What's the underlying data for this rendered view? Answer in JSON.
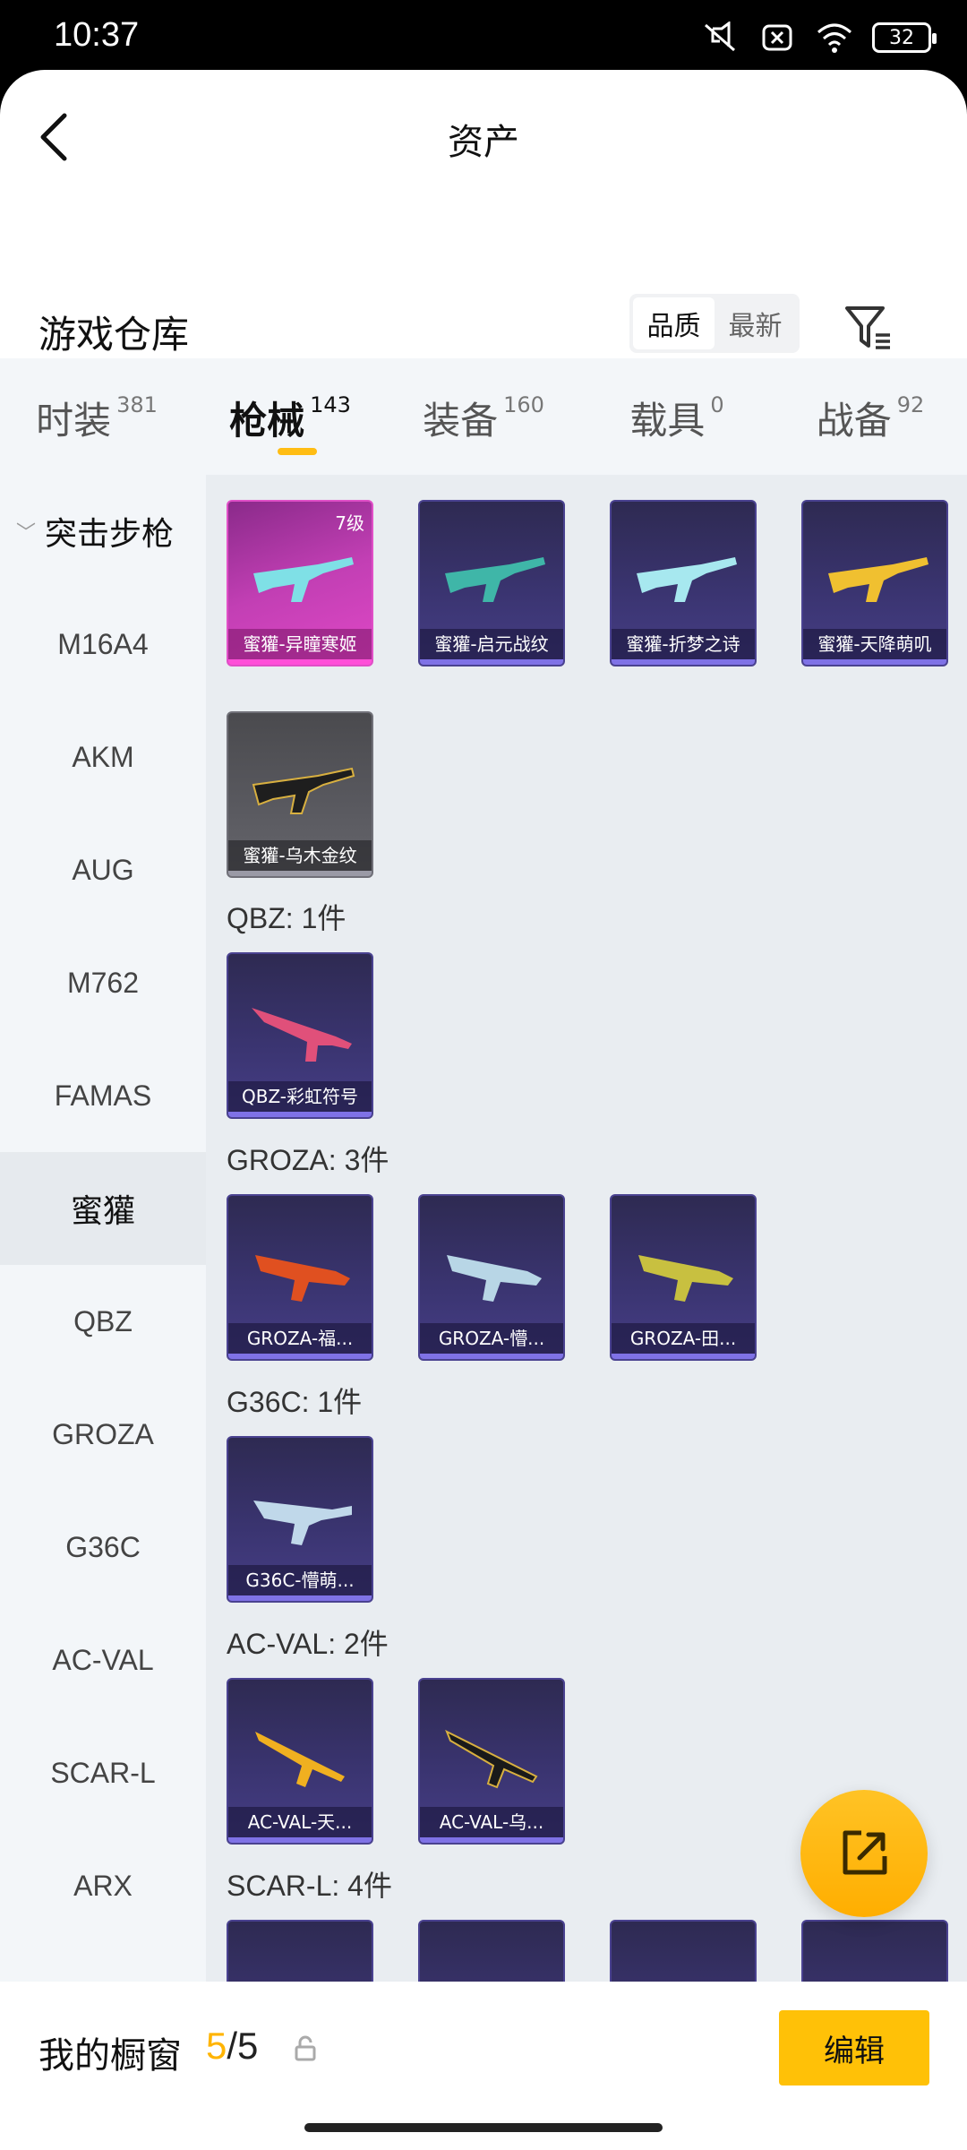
{
  "status_bar": {
    "time": "10:37",
    "battery": "32"
  },
  "header": {
    "title": "资产"
  },
  "warehouse": {
    "title": "游戏仓库",
    "sort_options": [
      "品质",
      "最新"
    ]
  },
  "tabs": [
    {
      "label": "时装",
      "count": "381"
    },
    {
      "label": "枪械",
      "count": "143"
    },
    {
      "label": "装备",
      "count": "160"
    },
    {
      "label": "载具",
      "count": "0"
    },
    {
      "label": "战备",
      "count": "92"
    }
  ],
  "sidebar": {
    "group": "突击步枪",
    "items": [
      "M16A4",
      "AKM",
      "AUG",
      "M762",
      "FAMAS",
      "蜜獾",
      "QBZ",
      "GROZA",
      "G36C",
      "AC-VAL",
      "SCAR-L",
      "ARX"
    ],
    "active": "蜜獾"
  },
  "sections": {
    "honeybadger": {
      "items": [
        {
          "name": "蜜獾-异瞳寒姬",
          "level": "7级"
        },
        {
          "name": "蜜獾-启元战纹"
        },
        {
          "name": "蜜獾-折梦之诗"
        },
        {
          "name": "蜜獾-天降萌叽"
        },
        {
          "name": "蜜獾-乌木金纹"
        }
      ]
    },
    "qbz": {
      "label": "QBZ: 1件",
      "items": [
        "QBZ-彩虹符号"
      ]
    },
    "groza": {
      "label": "GROZA: 3件",
      "items": [
        "GROZA-福...",
        "GROZA-懵...",
        "GROZA-田..."
      ]
    },
    "g36c": {
      "label": "G36C: 1件",
      "items": [
        "G36C-懵萌..."
      ]
    },
    "acval": {
      "label": "AC-VAL: 2件",
      "items": [
        "AC-VAL-天...",
        "AC-VAL-乌..."
      ]
    },
    "scarl": {
      "label": "SCAR-L: 4件"
    }
  },
  "bottom_bar": {
    "label": "我的橱窗",
    "count_current": "5",
    "count_total": "/5",
    "edit_label": "编辑"
  },
  "colors": {
    "accent": "#ffc107",
    "tab_indicator": "#ffbd14"
  }
}
